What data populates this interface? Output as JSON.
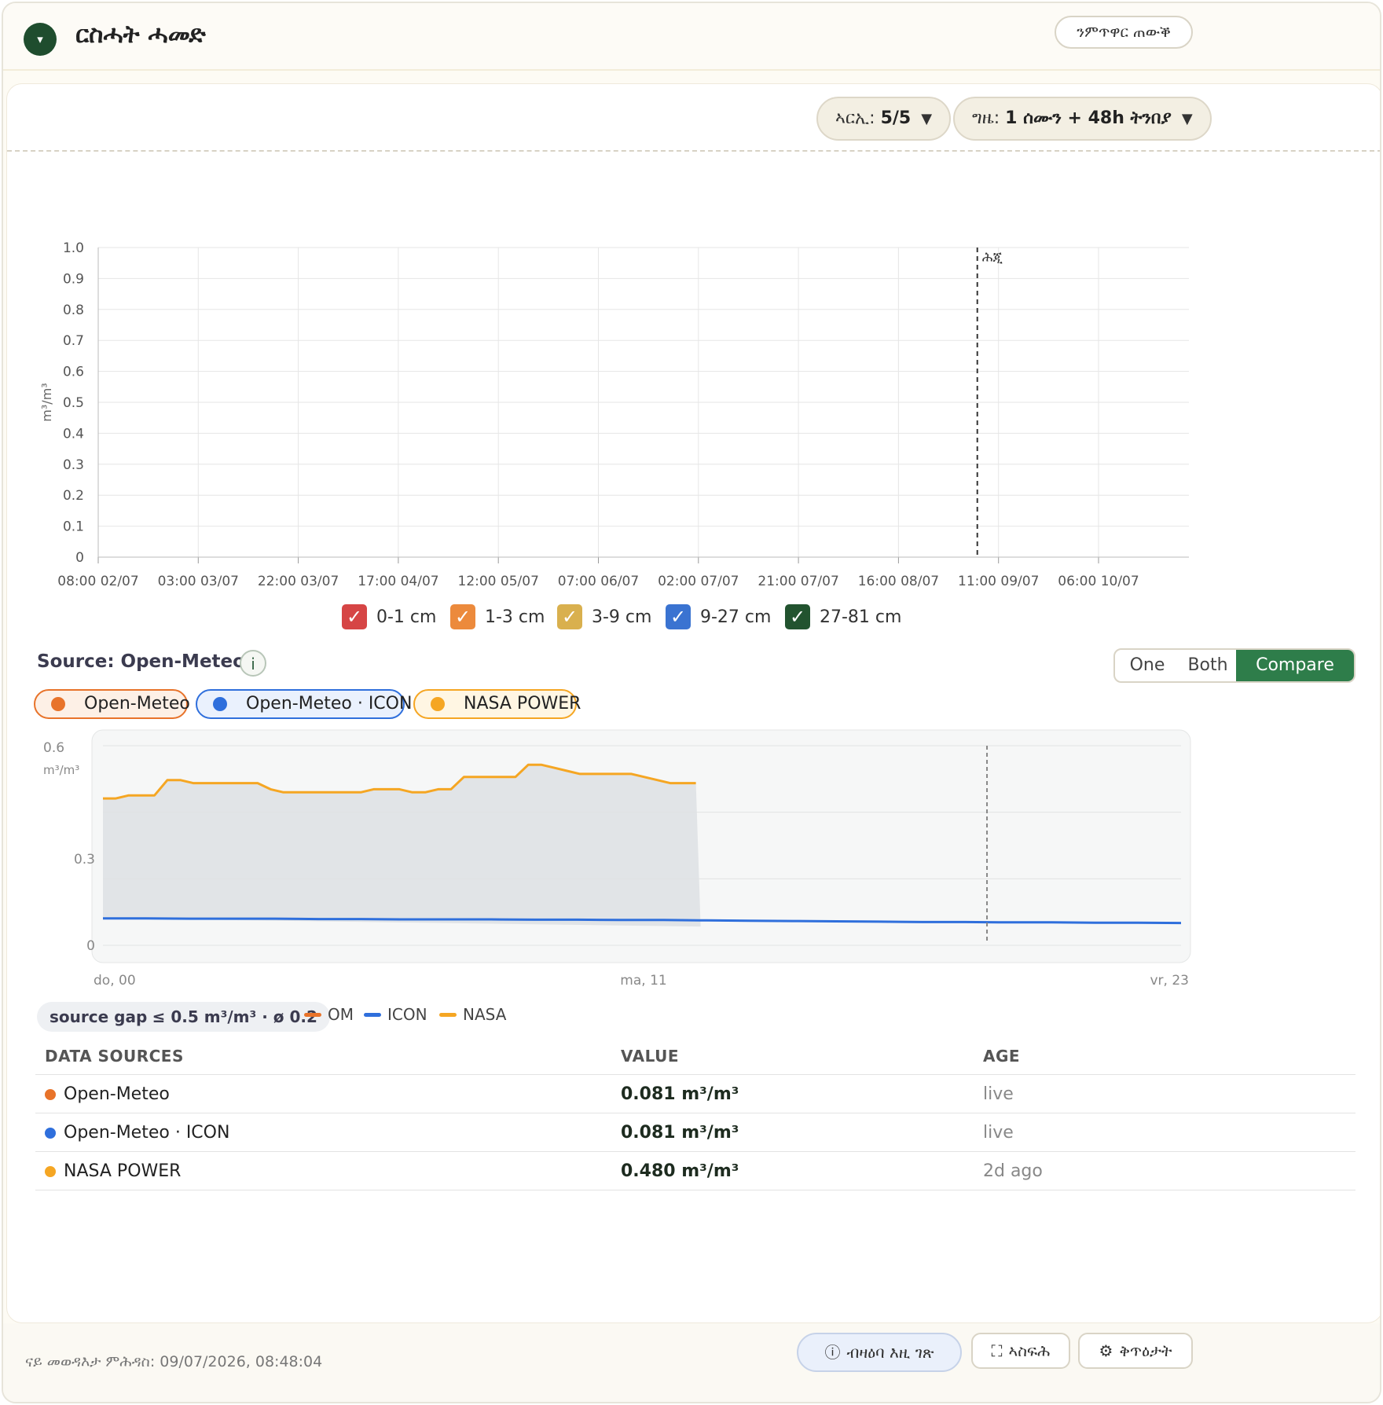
{
  "header": {
    "title": "ርስሓት ሓመድ",
    "collapse_icon": "▾",
    "compare_button": "ንምጥዋር ጠውቕ"
  },
  "selectors": {
    "depth_label": "ኣርኢ:",
    "depth_value": "5/5",
    "time_label": "ግዜ:",
    "time_value": "1 ሰሙን + 48h ትንበያ",
    "caret": "▼"
  },
  "main_chart": {
    "type": "line",
    "ylabel": "m³/m³",
    "ylim": [
      0,
      1.0
    ],
    "yticks": [
      "1.0",
      "0.9",
      "0.8",
      "0.7",
      "0.6",
      "0.5",
      "0.4",
      "0.3",
      "0.2",
      "0.1",
      "0"
    ],
    "x_ticks": [
      "08:00 02/07",
      "03:00 03/07",
      "22:00 03/07",
      "17:00 04/07",
      "12:00 05/07",
      "07:00 06/07",
      "02:00 07/07",
      "21:00 07/07",
      "16:00 08/07",
      "11:00 09/07",
      "06:00 10/07"
    ],
    "now_label": "ሕጂ",
    "now_position_fraction": 0.806,
    "series": [
      {
        "name": "0-1 cm",
        "color": "#d64545",
        "checked": true
      },
      {
        "name": "1-3 cm",
        "color": "#ec8a3c",
        "checked": true
      },
      {
        "name": "3-9 cm",
        "color": "#d9b04e",
        "checked": true
      },
      {
        "name": "9-27 cm",
        "color": "#3a73d1",
        "checked": true
      },
      {
        "name": "27-81 cm",
        "color": "#22532f",
        "checked": true
      }
    ]
  },
  "source": {
    "title": "Source: Open-Meteo",
    "info_icon": "i",
    "modes": [
      "One",
      "Both",
      "Compare"
    ],
    "active_mode": "Compare",
    "chips": [
      {
        "label": "Open-Meteo",
        "color": "#e8732a",
        "bg": "#fdf0e6"
      },
      {
        "label": "Open-Meteo · ICON",
        "color": "#2f6fdc",
        "bg": "#eaf1fd"
      },
      {
        "label": "NASA POWER",
        "color": "#f5a623",
        "bg": "#fff6e3"
      }
    ]
  },
  "chart_data": {
    "type": "line",
    "ylim": [
      0,
      0.6
    ],
    "yticks": [
      "0.6",
      "0.3",
      "0"
    ],
    "ylabel": "m³/m³",
    "x_labels": [
      "do, 00",
      "ma, 11",
      "vr, 23"
    ],
    "now_fraction": 0.82,
    "series": [
      {
        "name": "NASA",
        "color": "#f5a623",
        "values": [
          0.48,
          0.48,
          0.49,
          0.49,
          0.49,
          0.54,
          0.54,
          0.53,
          0.53,
          0.53,
          0.53,
          0.53,
          0.53,
          0.51,
          0.5,
          0.5,
          0.5,
          0.5,
          0.5,
          0.5,
          0.5,
          0.51,
          0.51,
          0.51,
          0.5,
          0.5,
          0.51,
          0.51,
          0.55,
          0.55,
          0.55,
          0.55,
          0.55,
          0.59,
          0.59,
          0.58,
          0.57,
          0.56,
          0.56,
          0.56,
          0.56,
          0.56,
          0.55,
          0.54,
          0.53,
          0.53,
          0.53
        ],
        "end_fraction": 0.55
      },
      {
        "name": "ICON",
        "color": "#2f6fdc",
        "values": [
          0.081,
          0.081,
          0.08,
          0.08,
          0.08,
          0.079,
          0.079,
          0.078,
          0.078,
          0.078,
          0.077,
          0.077,
          0.076,
          0.076,
          0.075,
          0.074,
          0.073,
          0.072,
          0.071,
          0.07,
          0.07,
          0.069,
          0.069,
          0.068,
          0.068,
          0.067
        ]
      },
      {
        "name": "OM",
        "color": "#e8732a",
        "values": []
      }
    ]
  },
  "gap_badge": {
    "label": "source gap",
    "value": "≤ 0.5 m³/m³ · ø 0.2"
  },
  "mini_legend": [
    {
      "label": "OM",
      "color": "#e8732a"
    },
    {
      "label": "ICON",
      "color": "#2f6fdc"
    },
    {
      "label": "NASA",
      "color": "#f5a623"
    }
  ],
  "table": {
    "headers": [
      "DATA SOURCES",
      "VALUE",
      "AGE"
    ],
    "rows": [
      {
        "name": "Open-Meteo",
        "value": "0.081 m³/m³",
        "age": "live",
        "color": "#e8732a"
      },
      {
        "name": "Open-Meteo · ICON",
        "value": "0.081 m³/m³",
        "age": "live",
        "color": "#2f6fdc"
      },
      {
        "name": "NASA POWER",
        "value": "0.480 m³/m³",
        "age": "2d ago",
        "color": "#f5a623"
      }
    ]
  },
  "footer": {
    "updated": "ናይ መወዳእታ ምሕዳስ: 09/07/2026, 08:48:04",
    "info_button": "ብዛዕባ እዚ ገጽ",
    "info_icon": "ⓘ",
    "expand_button": "ኣስፍሕ",
    "expand_icon": "⛶",
    "settings_button": "ቅጥዕታት",
    "settings_icon": "⚙"
  }
}
